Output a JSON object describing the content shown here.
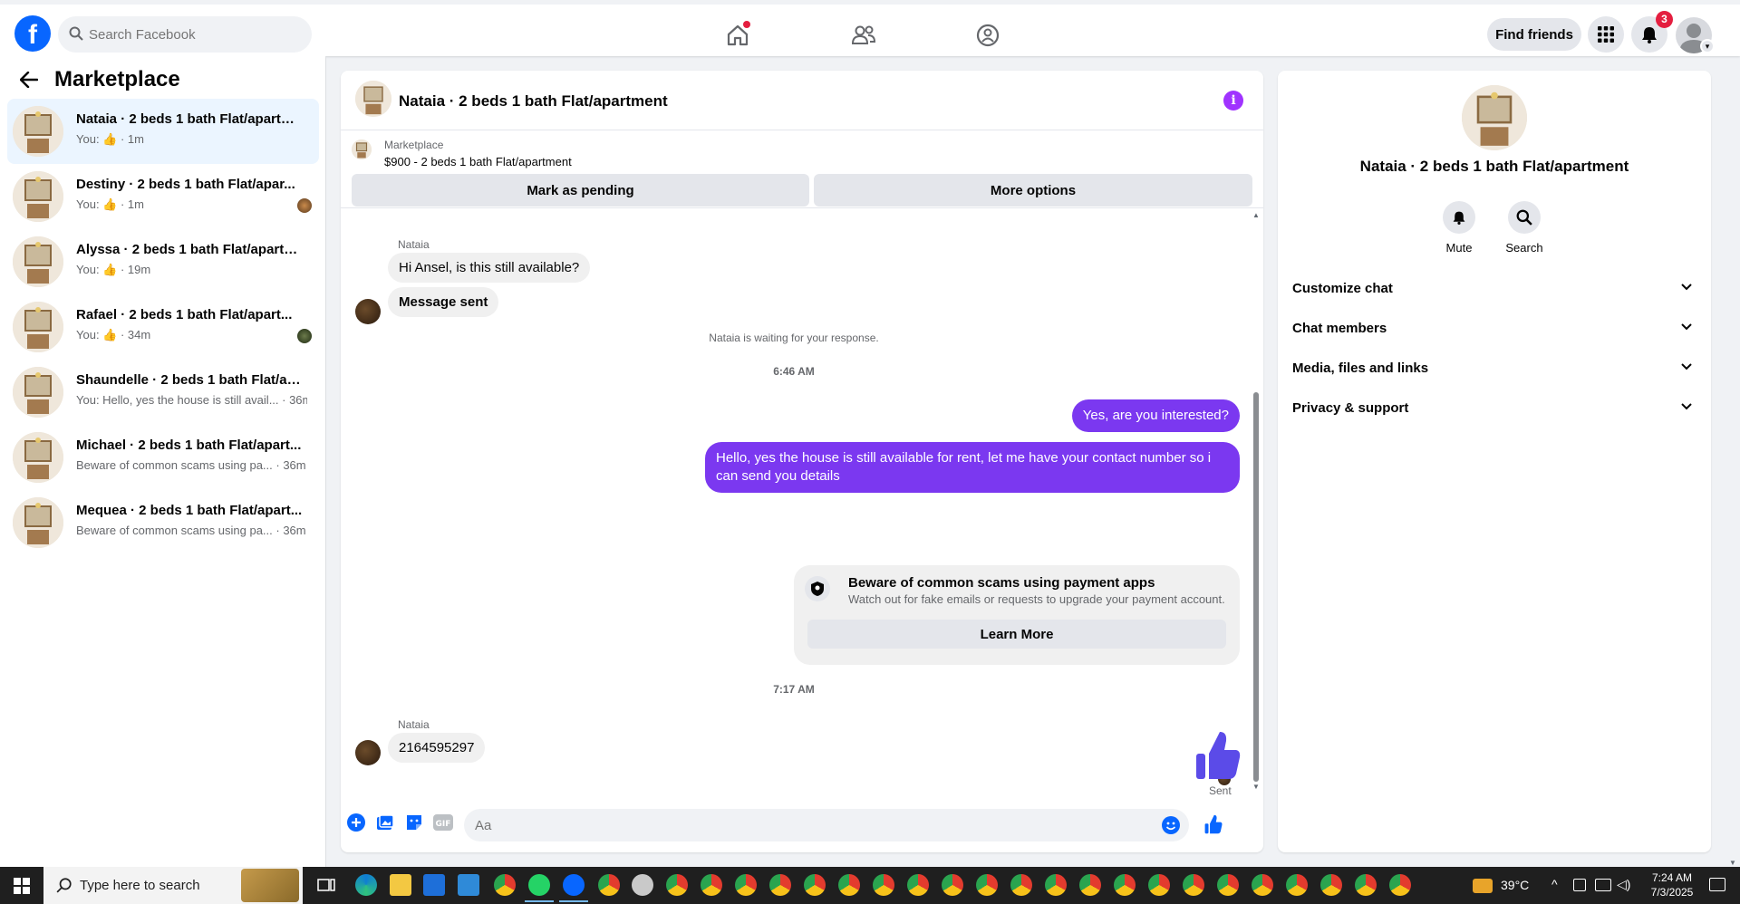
{
  "topbar": {
    "logo": "f",
    "search_placeholder": "Search Facebook",
    "find_friends": "Find friends",
    "notification_count": "3"
  },
  "sidebar": {
    "title": "Marketplace",
    "conversations": [
      {
        "title": "Nataia · 2 beds 1 bath Flat/apartm...",
        "sub": "You: 👍 · 1m",
        "active": true
      },
      {
        "title": "Destiny · 2 beds 1 bath Flat/apar...",
        "sub": "You: 👍 · 1m"
      },
      {
        "title": "Alyssa · 2 beds 1 bath Flat/apartm...",
        "sub": "You: 👍 · 19m"
      },
      {
        "title": "Rafael · 2 beds 1 bath Flat/apart...",
        "sub": "You: 👍 · 34m"
      },
      {
        "title": "Shaundelle · 2 beds 1 bath Flat/ap...",
        "sub": "You: Hello, yes the house is still avail... · 36m"
      },
      {
        "title": "Michael · 2 beds 1 bath Flat/apart...",
        "sub": "Beware of common scams using pa... · 36m"
      },
      {
        "title": "Mequea · 2 beds 1 bath Flat/apart...",
        "sub": "Beware of common scams using pa... · 36m"
      }
    ]
  },
  "chat": {
    "header_name": "Nataia · 2 beds 1 bath Flat/apartment",
    "info_icon": "i",
    "listing_label": "Marketplace",
    "listing_price": "$900 - 2 beds 1 bath Flat/apartment",
    "mark_pending": "Mark as pending",
    "more_options": "More options",
    "sender_1": "Nataia",
    "msg_1": "Hi Ansel, is this still available?",
    "msg_2": "Message sent",
    "waiting": "Nataia is waiting for your response.",
    "time_1": "6:46 AM",
    "out_1": "Yes, are you interested?",
    "out_2": "Hello, yes the house is still available for rent, let me have your contact number so i can send you details",
    "scam_title": "Beware of common scams using payment apps",
    "scam_sub": "Watch out for fake emails or requests to upgrade your payment account.",
    "learn_more": "Learn More",
    "time_2": "7:17 AM",
    "sender_2": "Nataia",
    "msg_3": "2164595297",
    "sent_label": "Sent",
    "composer_placeholder": "Aa"
  },
  "details": {
    "name": "Nataia · 2 beds 1 bath Flat/apartment",
    "mute": "Mute",
    "search": "Search",
    "sections": [
      "Customize chat",
      "Chat members",
      "Media, files and links",
      "Privacy & support"
    ]
  },
  "taskbar": {
    "search_placeholder": "Type here to search",
    "weather": "39°C",
    "time": "7:24 AM",
    "date": "7/3/2025"
  },
  "colors": {
    "accent": "#7b38f0",
    "fb_blue": "#0866ff",
    "notification_red": "#e41e3f"
  }
}
